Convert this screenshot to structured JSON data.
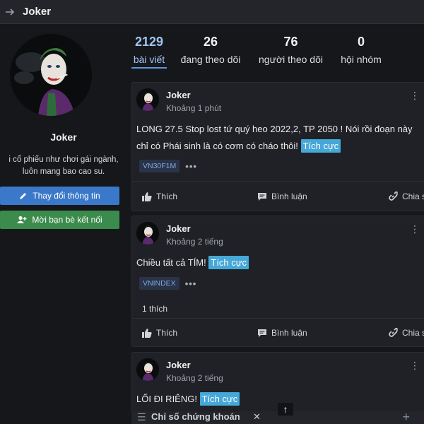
{
  "header": {
    "title": "Joker"
  },
  "profile": {
    "name": "Joker",
    "bio_line1": "i cổ phiếu như chơi gái ngành,",
    "bio_line2": "luôn mang bao cao su.",
    "edit_button": "Thay đổi thông tin",
    "invite_button": "Mời bạn bè kết nối"
  },
  "stats": [
    {
      "value": "2129",
      "label": "bài viết"
    },
    {
      "value": "26",
      "label": "đang theo dõi"
    },
    {
      "value": "76",
      "label": "người theo dõi"
    },
    {
      "value": "0",
      "label": "hội nhóm"
    }
  ],
  "posts": [
    {
      "author": "Joker",
      "time": "Khoảng 1 phút",
      "line1": "LONG 27.5 Stop lost tứ quý heo 2022,2, TP 2050 ! Nói rồi đoạn này",
      "line2": "chỉ có Phái sinh là có cơm có cháo thôi!",
      "sentiment": "Tích cực",
      "tag": "VN30F1M",
      "likes": "",
      "like_label": "Thích",
      "comment_label": "Bình luận",
      "share_label": "Chia s"
    },
    {
      "author": "Joker",
      "time": "Khoảng 2 tiếng",
      "line1": "Chiều tất cả TÍM!",
      "sentiment": "Tích cực",
      "tag": "VNINDEX",
      "likes": "1 thích",
      "like_label": "Thích",
      "comment_label": "Bình luận",
      "share_label": "Chia s"
    },
    {
      "author": "Joker",
      "time": "Khoảng 2 tiếng",
      "line1": "LỐI ĐI RIÊNG!",
      "sentiment": "Tích cực"
    }
  ],
  "bottom_bar": {
    "title": "Chỉ số chứng khoán"
  },
  "colors": {
    "background": "#16171b",
    "card": "#1f2126",
    "accent_blue": "#3a78c9",
    "accent_green": "#3b8b4c",
    "sentiment": "#45a8d8",
    "active_stat": "#9fc6f2"
  },
  "icons": [
    "arrow-right-icon",
    "pencil-icon",
    "add-user-icon",
    "like-icon",
    "comment-icon",
    "share-icon",
    "more-icon",
    "menu-icon",
    "close-icon",
    "plus-icon",
    "arrow-up-icon"
  ]
}
